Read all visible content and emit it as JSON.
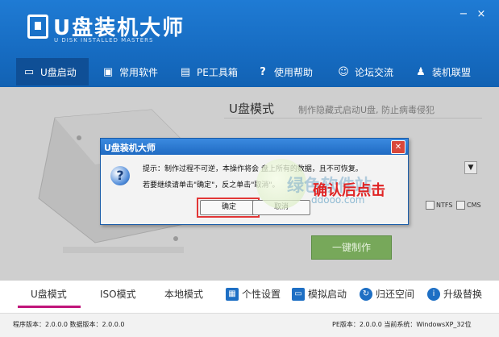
{
  "window": {
    "title": "U盘装机大师",
    "subtitle": "U DISK INSTALLED MASTERS",
    "minimize": "−",
    "close": "×"
  },
  "nav": [
    {
      "label": "U盘启动",
      "icon": "usb-icon"
    },
    {
      "label": "常用软件",
      "icon": "software-icon"
    },
    {
      "label": "PE工具箱",
      "icon": "toolbox-icon"
    },
    {
      "label": "使用帮助",
      "icon": "help-icon"
    },
    {
      "label": "论坛交流",
      "icon": "forum-icon"
    },
    {
      "label": "装机联盟",
      "icon": "users-icon"
    }
  ],
  "main": {
    "mode_title": "U盘模式",
    "mode_desc": "制作隐藏式启动U盘, 防止病毒侵犯",
    "ntfs": "NTFS",
    "cms": "CMS",
    "make_button": "一键制作"
  },
  "tabs": [
    "U盘模式",
    "ISO模式",
    "本地模式"
  ],
  "tools": [
    {
      "label": "个性设置",
      "icon": "grid-icon"
    },
    {
      "label": "模拟启动",
      "icon": "monitor-icon"
    },
    {
      "label": "归还空间",
      "icon": "refresh-icon"
    },
    {
      "label": "升级替换",
      "icon": "info-icon"
    }
  ],
  "status": {
    "left": "程序版本：2.0.0.0  数据版本：2.0.0.0",
    "right": "PE版本：2.0.0.0  当前系统：WindowsXP_32位"
  },
  "dialog": {
    "title": "U盘装机大师",
    "msg1": "提示：制作过程不可逆，本操作将会  盘上所有的数据，且不可恢复。",
    "msg2": "若要继续请单击\"确定\"，反之单击\"取消\"。",
    "ok": "确定",
    "cancel": "取消"
  },
  "watermark": {
    "text": "绿色软件站",
    "sub": "ddooo.com"
  },
  "annotation": "确认后点击",
  "colors": {
    "header": "#1a6fc8",
    "accent": "#c0157a",
    "annotation": "#e02424"
  }
}
